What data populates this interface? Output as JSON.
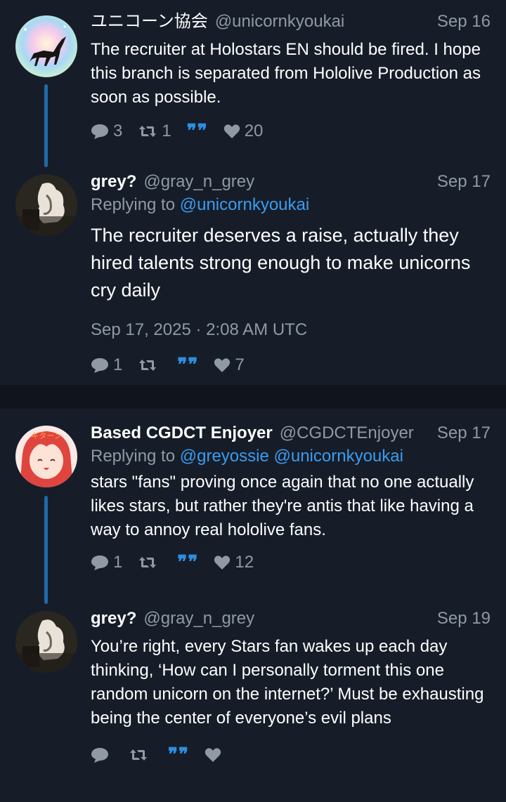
{
  "tweets": [
    {
      "display_name": "ユニコーン協会",
      "handle": "@unicornkyoukai",
      "date": "Sep 16",
      "replying_to_label": "",
      "mentions": "",
      "text": "The recruiter at Holostars EN should be fired. I hope this branch is separated from Hololive Production as soon as possible.",
      "replies": "3",
      "retweets": "1",
      "likes": "20"
    },
    {
      "display_name": "grey?",
      "handle": "@gray_n_grey",
      "date": "Sep 17",
      "replying_to_label": "Replying to",
      "mentions": "@unicornkyoukai",
      "text": "The recruiter deserves a raise, actually they hired talents strong enough to make unicorns cry daily",
      "timestamp": "Sep 17, 2025 · 2:08 AM UTC",
      "replies": "1",
      "retweets": "",
      "likes": "7"
    },
    {
      "display_name": "Based CGDCT Enjoyer",
      "handle": "@CGDCTEnjoyer",
      "date": "Sep 17",
      "replying_to_label": "Replying to",
      "mentions": "@greyossie @unicornkyoukai",
      "text": "stars \"fans\" proving once again that no one actually likes stars, but rather they're antis that like having a way to annoy real hololive fans.",
      "replies": "1",
      "retweets": "",
      "likes": "12"
    },
    {
      "display_name": "grey?",
      "handle": "@gray_n_grey",
      "date": "Sep 19",
      "replying_to_label": "",
      "mentions": "",
      "text": "You’re right, every Stars fan wakes up each day thinking, ‘How can I personally torment this one random unicorn on the internet?’ Must be exhausting being the center of everyone’s evil plans",
      "replies": "",
      "retweets": "",
      "likes": ""
    }
  ],
  "icons": {
    "reply": "comment-icon",
    "retweet": "retweet-icon",
    "quote": "quote-icon",
    "like": "heart-icon"
  },
  "colors": {
    "background": "#161d28",
    "accent": "#3b9bf0",
    "muted": "#8f9aa6",
    "thread_line": "#1f6aa8"
  }
}
